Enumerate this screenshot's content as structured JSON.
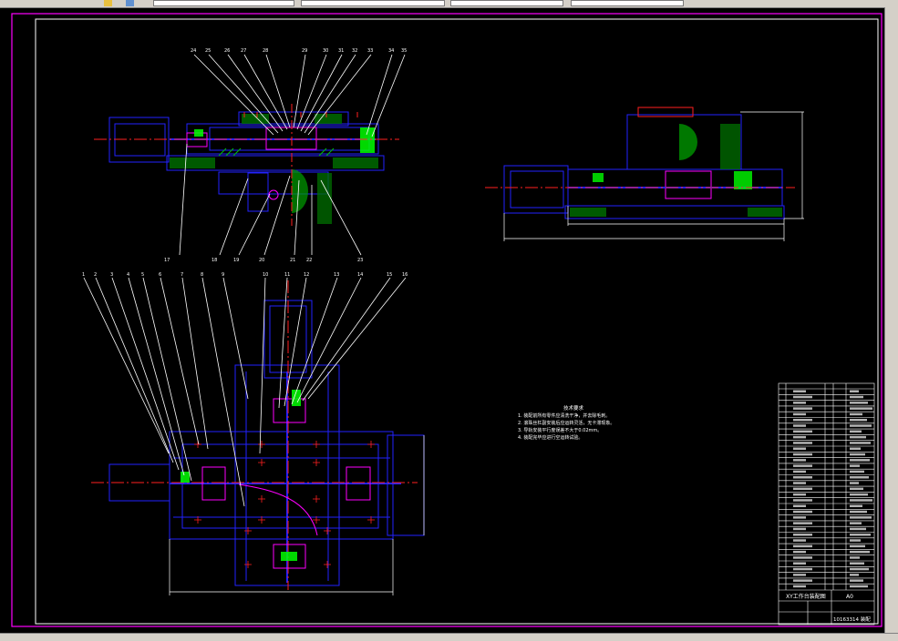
{
  "toolbar": {
    "segments": [
      "",
      "",
      "",
      "",
      ""
    ]
  },
  "drawing": {
    "notes_title": "技术要求",
    "notes": [
      "1. 装配前所有零件应清洗干净，并去除毛刺。",
      "2. 滚珠丝杠副安装后应运转灵活，无卡滞现象。",
      "3. 导轨安装平行度误差不大于0.02mm。",
      "4. 装配完毕应进行空运转试验。"
    ],
    "dim_bottom_left": "",
    "dim_right_view": "",
    "top_callouts": [
      "24",
      "25",
      "26",
      "27",
      "28",
      "29",
      "30",
      "31",
      "32",
      "33",
      "34",
      "35"
    ],
    "top_lower_callouts": [
      "17",
      "18",
      "19",
      "20",
      "21",
      "22",
      "23"
    ],
    "plan_callouts": [
      "1",
      "2",
      "3",
      "4",
      "5",
      "6",
      "7",
      "8",
      "9",
      "10",
      "11",
      "12",
      "13",
      "14",
      "15",
      "16"
    ],
    "title_block": {
      "title": "XY工作台装配图",
      "scale": "A0",
      "drawing_no": "10163314 装配"
    }
  },
  "colors": {
    "frame_magenta": "#ff00ff",
    "line_white": "#ffffff",
    "line_blue": "#2222ff",
    "line_red": "#ff2020",
    "line_green": "#00ff00",
    "hatch_green": "#00c000",
    "accent_magenta": "#ff00ff"
  }
}
